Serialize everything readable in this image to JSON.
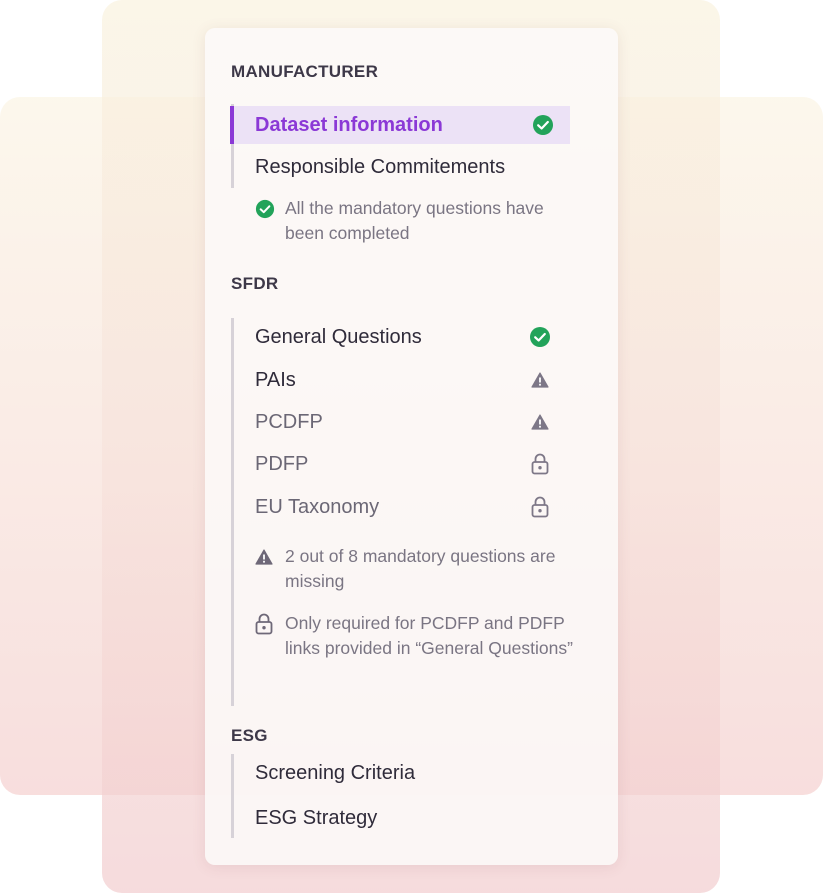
{
  "sections": {
    "manufacturer": {
      "title": "MANUFACTURER",
      "items": [
        {
          "label": "Dataset information",
          "status": "check-circle-icon",
          "active": true
        },
        {
          "label": "Responsible Commitements",
          "status": "",
          "active": false
        }
      ],
      "note": {
        "icon": "check-circle-icon",
        "text": "All the mandatory questions have been completed"
      }
    },
    "sfdr": {
      "title": "SFDR",
      "items": [
        {
          "label": "General Questions",
          "status": "check-circle-icon"
        },
        {
          "label": "PAIs",
          "status": "warning-icon"
        },
        {
          "label": "PCDFP",
          "status": "warning-icon"
        },
        {
          "label": "PDFP",
          "status": "lock-icon"
        },
        {
          "label": "EU Taxonomy",
          "status": "lock-icon"
        }
      ],
      "notes": [
        {
          "icon": "warning-icon",
          "text": "2 out of 8 mandatory questions are missing"
        },
        {
          "icon": "lock-icon",
          "text": "Only required for PCDFP and PDFP links provided in “General Questions”"
        }
      ]
    },
    "esg": {
      "title": "ESG",
      "items": [
        {
          "label": "Screening Criteria"
        },
        {
          "label": "ESG Strategy"
        }
      ]
    }
  },
  "colors": {
    "accent": "#8b39d6",
    "active_bg": "#ece2f6",
    "success": "#22a35a",
    "muted_icon": "#7d7787"
  }
}
